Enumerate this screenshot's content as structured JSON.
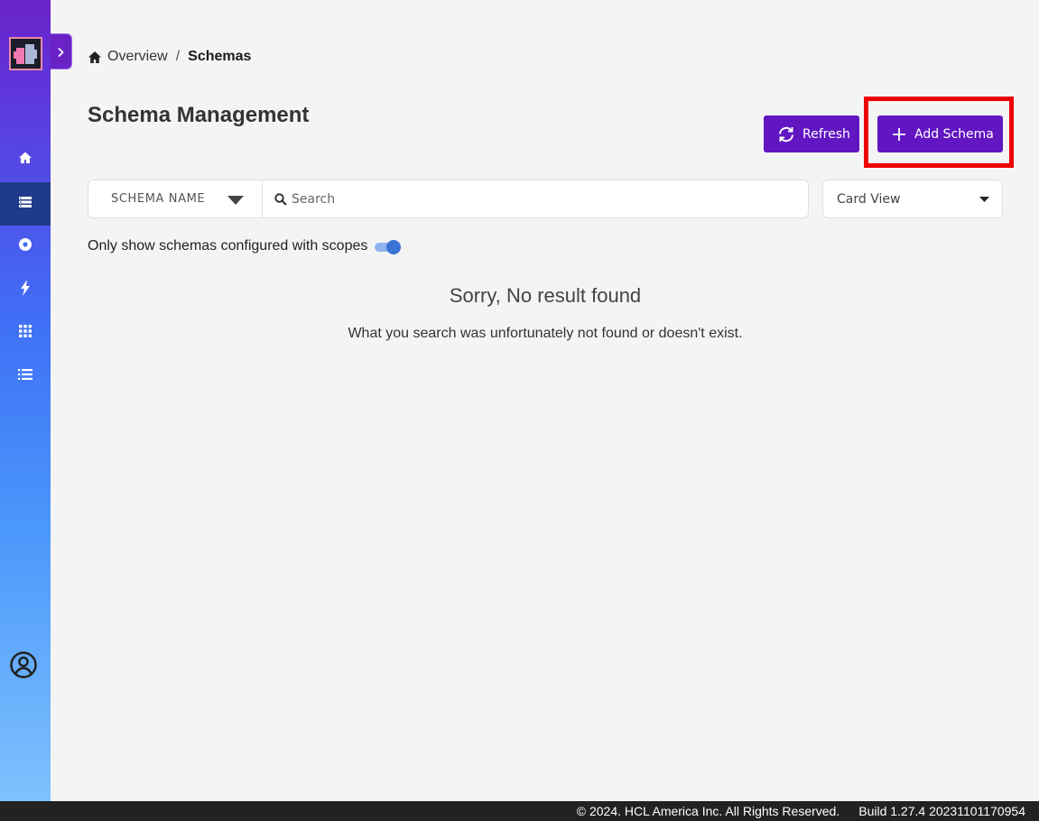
{
  "sidebar": {
    "logo": "app-logo",
    "items": [
      {
        "icon": "home-icon",
        "active": false
      },
      {
        "icon": "schema-list-icon",
        "active": true
      },
      {
        "icon": "disc-icon",
        "active": false
      },
      {
        "icon": "bolt-icon",
        "active": false
      },
      {
        "icon": "apps-grid-icon",
        "active": false
      },
      {
        "icon": "list-icon",
        "active": false
      }
    ],
    "profile_icon": "user-circle-icon"
  },
  "breadcrumb": {
    "home": "Overview",
    "separator": "/",
    "current": "Schemas"
  },
  "page": {
    "title": "Schema Management"
  },
  "toolbar": {
    "refresh_label": "Refresh",
    "add_label": "Add Schema"
  },
  "filter": {
    "field": "SCHEMA NAME",
    "search_placeholder": "Search",
    "search_value": "",
    "view": "Card View",
    "scope_toggle_label": "Only show schemas configured with scopes",
    "scope_toggle_on": true
  },
  "empty_state": {
    "title": "Sorry, No result found",
    "description": "What you search was unfortunately not found or doesn't exist."
  },
  "footer": {
    "copyright": "© 2024. HCL America Inc. All Rights Reserved.",
    "build": "Build 1.27.4 20231101170954"
  },
  "colors": {
    "primary": "#6116c2",
    "highlight": "#ee0000",
    "toggle_on": "#3a73d6"
  }
}
